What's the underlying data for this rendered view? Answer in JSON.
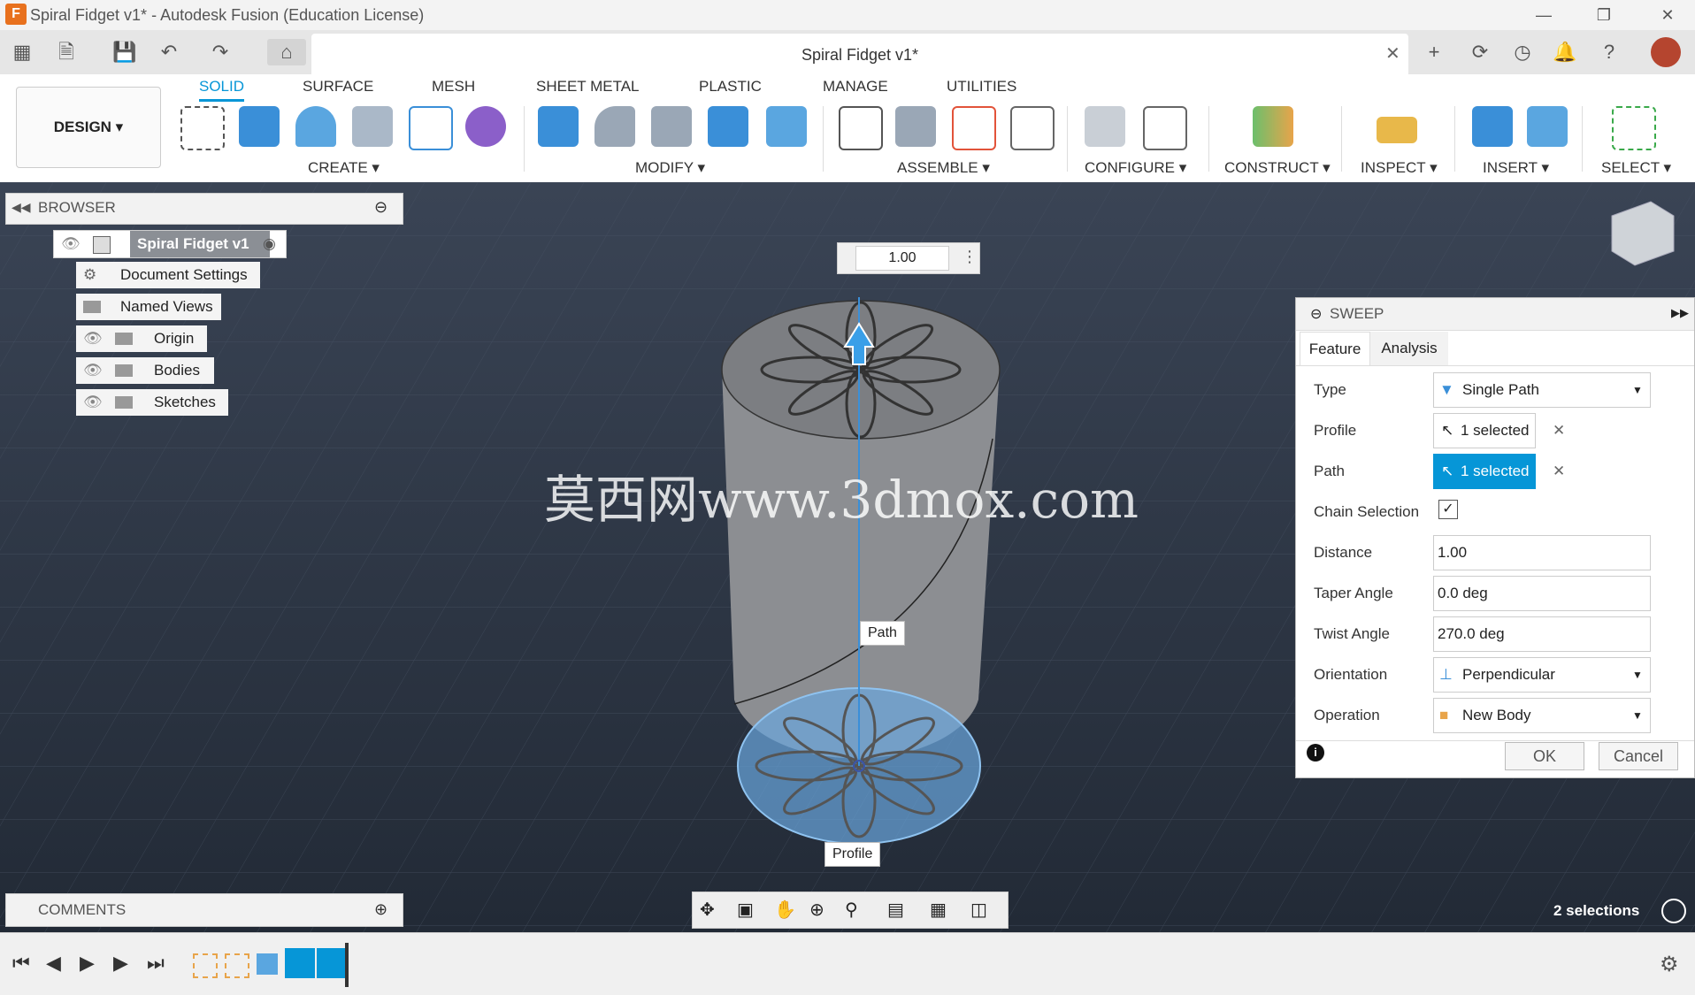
{
  "window": {
    "title": "Spiral Fidget v1* - Autodesk Fusion (Education License)",
    "app_icon": "F"
  },
  "tab": {
    "title": "Spiral Fidget v1*"
  },
  "ribbon": {
    "workspace": "DESIGN",
    "tabs": [
      "SOLID",
      "SURFACE",
      "MESH",
      "SHEET METAL",
      "PLASTIC",
      "MANAGE",
      "UTILITIES"
    ],
    "active_tab": "SOLID",
    "groups": [
      "CREATE",
      "MODIFY",
      "ASSEMBLE",
      "CONFIGURE",
      "CONSTRUCT",
      "INSPECT",
      "INSERT",
      "SELECT"
    ]
  },
  "browser": {
    "title": "BROWSER",
    "root": "Spiral Fidget v1",
    "items": [
      "Document Settings",
      "Named Views",
      "Origin",
      "Bodies",
      "Sketches"
    ]
  },
  "viewport": {
    "distance_input": "1.00",
    "path_label": "Path",
    "profile_label": "Profile",
    "watermark": "莫西网www.3dmox.com",
    "selections": "2 selections"
  },
  "sweep": {
    "title": "SWEEP",
    "tabs": [
      "Feature",
      "Analysis"
    ],
    "rows": {
      "type": {
        "label": "Type",
        "value": "Single Path"
      },
      "profile": {
        "label": "Profile",
        "value": "1 selected"
      },
      "path": {
        "label": "Path",
        "value": "1 selected"
      },
      "chain": {
        "label": "Chain Selection",
        "checked": true
      },
      "distance": {
        "label": "Distance",
        "value": "1.00"
      },
      "taper": {
        "label": "Taper Angle",
        "value": "0.0 deg"
      },
      "twist": {
        "label": "Twist Angle",
        "value": "270.0 deg"
      },
      "orientation": {
        "label": "Orientation",
        "value": "Perpendicular"
      },
      "operation": {
        "label": "Operation",
        "value": "New Body"
      }
    },
    "ok": "OK",
    "cancel": "Cancel"
  },
  "comments": {
    "title": "COMMENTS"
  },
  "colors": {
    "accent": "#0696d7",
    "selected_field": "#0696d7",
    "viewport_bg": "#2b3442"
  }
}
